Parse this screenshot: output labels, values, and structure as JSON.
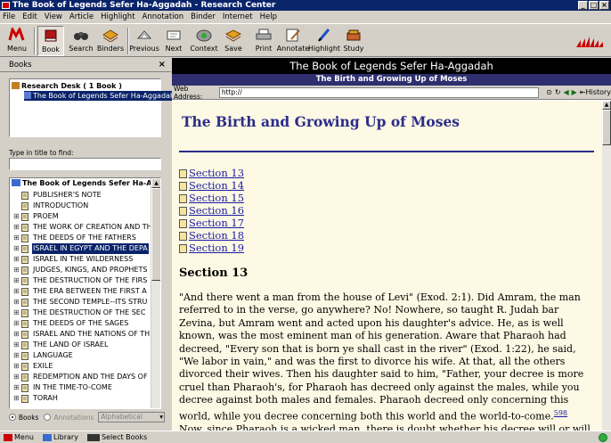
{
  "window": {
    "title": "The Book of Legends Sefer Ha-Aggadah - Research Center"
  },
  "menu": [
    "File",
    "Edit",
    "View",
    "Article",
    "Highlight",
    "Annotation",
    "Binder",
    "Internet",
    "Help"
  ],
  "toolbar": {
    "menu": "Menu",
    "book": "Book",
    "search": "Search",
    "binders": "Binders",
    "previous": "Previous",
    "next": "Next",
    "context": "Context",
    "save": "Save",
    "print": "Print",
    "annotate": "Annotate",
    "highlight": "Highlight",
    "study": "Study"
  },
  "left_panel": {
    "header": "Books",
    "research_desk": "Research Desk ( 1 Book )",
    "desk_book": "The Book of Legends Sefer Ha-Aggadah",
    "find_label": "Type in title to find:",
    "find_value": "",
    "tree_title": "The Book of Legends Sefer Ha-Aggadah",
    "tree_items": [
      "PUBLISHER'S NOTE",
      "INTRODUCTION",
      "PROEM",
      "THE WORK OF CREATION AND THE",
      "THE DEEDS OF THE FATHERS",
      "ISRAEL IN EGYPT AND THE DEPA",
      "ISRAEL IN THE WILDERNESS",
      "JUDGES, KINGS, AND PROPHETS",
      "THE DESTRUCTION OF THE FIRS",
      "THE ERA BETWEEN THE FIRST A",
      "THE SECOND TEMPLE--ITS STRU",
      "THE DESTRUCTION OF THE SEC",
      "THE DEEDS OF THE SAGES",
      "ISRAEL AND THE NATIONS OF TH",
      "THE LAND OF ISRAEL",
      "LANGUAGE",
      "EXILE",
      "REDEMPTION AND THE DAYS OF",
      "IN THE TIME-TO-COME",
      "TORAH"
    ],
    "footer": {
      "books": "Books",
      "annotations": "Annotations",
      "sort": "Alphabetical"
    }
  },
  "content": {
    "book_title": "The Book of Legends Sefer Ha-Aggadah",
    "section_title": "The Birth and Growing Up of Moses",
    "address_label": "Web Address:",
    "address_value": "http://",
    "history": "History",
    "chapter_title": "The Birth and Growing Up of Moses",
    "links": [
      "Section 13",
      "Section 14",
      "Section 15",
      "Section 16",
      "Section 17",
      "Section 18",
      "Section 19"
    ],
    "section_heading": "Section 13",
    "body_1": "\"And there went a man from the house of Levi\" (Exod. 2:1). Did Amram, the man referred to in the verse, go anywhere? No! Nowhere, so taught R. Judah bar Zevina, but Amram went and acted upon his daughter's advice. He, as is well known, was the most eminent man of his generation. Aware that Pharaoh had decreed, \"Every son that is born ye shall cast in the river\" (Exod. 1:22), he said, \"We labor in vain,\" and was the first to divorce his wife. At that, all the others divorced their wives. Then his daughter said to him, \"Father, your decree is more cruel than Pharaoh's, for Pharaoh has decreed only against the males, while you decree against both males and females. Pharaoh decreed only concerning this world, while you decree concerning both this world and the world-to-come.",
    "footnote": "598",
    "body_2": " Now, since Pharaoh is a wicked man, there is doubt whether his decree will or will not be fulfilled; but since you are a righteous man, your decree is sure to be fulfilled.\" At once he went and took back his wife."
  },
  "statusbar": {
    "menu": "Menu",
    "library": "Library",
    "select_books": "Select Books"
  }
}
